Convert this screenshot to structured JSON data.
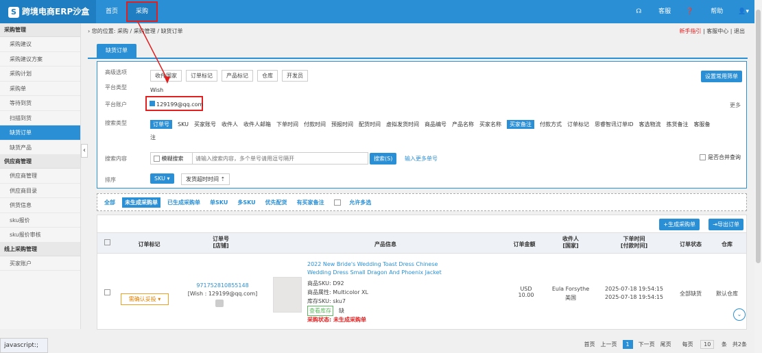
{
  "app": {
    "logo_text": "跨境电商ERP沙盒",
    "nav": [
      "首页",
      "采购"
    ],
    "right": [
      "客服",
      "帮助"
    ]
  },
  "sidebar": {
    "groups": [
      {
        "title": "采购管理",
        "items": [
          "采购建议",
          "采购建议方案",
          "采购计划",
          "采购单",
          "等待到货",
          "扫描到货",
          "缺货订单",
          "缺货产品"
        ]
      },
      {
        "title": "供应商管理",
        "items": [
          "供应商管理",
          "供应商目录",
          "供货信息",
          "sku报价",
          "sku报价审核"
        ]
      },
      {
        "title": "线上采购管理",
        "items": [
          "买家账户"
        ]
      }
    ],
    "active_item": "缺货订单"
  },
  "breadcrumb": {
    "prefix": "您的位置:",
    "path": [
      "采购",
      "采购管理",
      "缺货订单"
    ],
    "right": [
      "新手指引",
      "客服中心",
      "退出"
    ]
  },
  "tab": "缺货订单",
  "filter": {
    "advanced_label": "高级选项",
    "advanced_dropdowns": [
      "收件国家",
      "订单标记",
      "产品标记",
      "仓库",
      "开发员"
    ],
    "set_common": "设置常用筛单",
    "platform_type_label": "平台类型",
    "platform_type_value": "Wish",
    "platform_account_label": "平台账户",
    "platform_account_value": "129199@qq.com",
    "more": "更多",
    "search_type_label": "搜索类型",
    "search_types": [
      "订单号",
      "SKU",
      "买家账号",
      "收件人",
      "收件人邮箱",
      "下单时间",
      "付款时间",
      "预报时间",
      "配货时间",
      "虚拟发货时间",
      "商品编号",
      "产品名称",
      "买家名称",
      "买家备注",
      "付款方式",
      "订单标记",
      "思睿智讯订单ID",
      "客选物流",
      "拣货备注",
      "客服备注"
    ],
    "search_content_label": "搜索内容",
    "fuzzy": "模糊搜索",
    "search_placeholder": "请输入搜索内容，多个单号请用逗号隔开",
    "search_button": "搜索(S)",
    "more_orders": "输入更多单号",
    "merge_query": "是否合并查询",
    "sort_label": "排序",
    "sort_primary": "SKU",
    "sort_secondary": "发货超时时间"
  },
  "status_tabs": [
    "全部",
    "未生成采购单",
    "已生成采购单",
    "单SKU",
    "多SKU",
    "优先配货",
    "有买家备注"
  ],
  "allow_multi": "允许多选",
  "toolbar": {
    "generate": "+生成采购单",
    "export": "导出订单"
  },
  "table": {
    "headers": [
      "订单标记",
      "订单号\n[店铺]",
      "产品信息",
      "订单金额",
      "收件人\n[国家]",
      "下单时间\n[付款时间]",
      "订单状态",
      "仓库"
    ],
    "row": {
      "mark": "需确认妥投",
      "order_no": "971752810855148",
      "store": "[Wish : 129199@qq.com]",
      "title": "2022 New Bride's Wedding Toast Dress Chinese Wedding Dress Small Dragon And Phoenix Jacket",
      "sku": "商品SKU: D92",
      "attr": "商品属性: Multicolor XL",
      "stock_sku": "库存SKU: sku7",
      "stock_btn": "查看库存",
      "lack": "缺",
      "purchase_status": "采购状态: 未生成采购单",
      "amount": "USD 10.00",
      "recipient": "Eula Forsythe",
      "country": "美国",
      "order_time": "2025-07-18 19:54:15",
      "pay_time": "2025-07-18 19:54:15",
      "status": "全部缺货",
      "warehouse": "默认仓库"
    }
  },
  "pager": {
    "first": "首页",
    "prev": "上一页",
    "current": "1",
    "next": "下一页",
    "last": "尾页",
    "per_page": "每页",
    "per_value": "10",
    "unit": "条",
    "total": "共2条"
  },
  "status_bar": "javascript:;"
}
